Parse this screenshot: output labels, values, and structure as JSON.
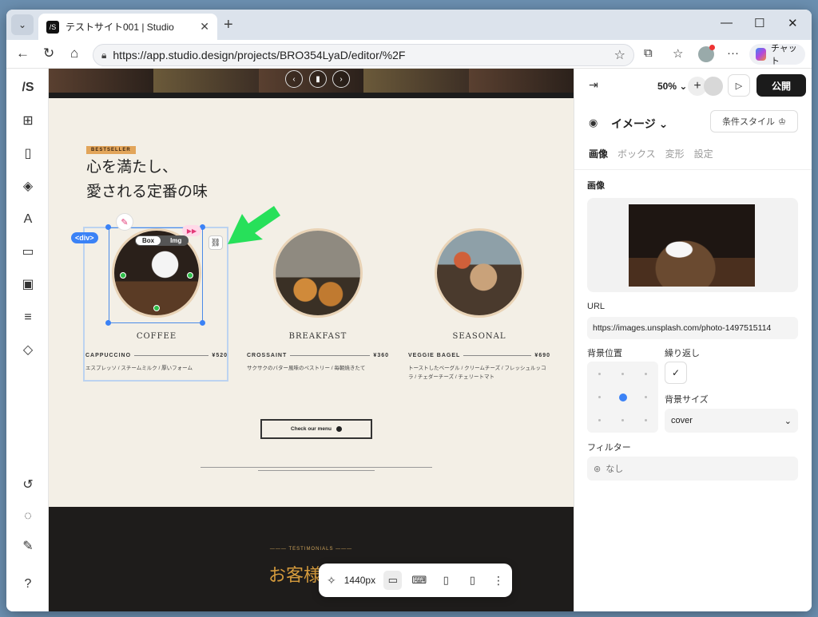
{
  "browser": {
    "tab_title": "テストサイト001 | Studio",
    "url": "https://app.studio.design/projects/BRO354LyaD/editor/%2F",
    "copilot_label": "チャット"
  },
  "canvas": {
    "badge": "BESTSELLER",
    "headline_line1": "心を満たし、",
    "headline_line2": "愛される定番の味",
    "items": [
      {
        "name": "COFFEE",
        "label": "CAPPUCCINO",
        "price": "¥520",
        "desc": "エスプレッソ / スチームミルク / 厚いフォーム"
      },
      {
        "name": "BREAKFAST",
        "label": "CROSSAINT",
        "price": "¥360",
        "desc": "サクサクのバター風味のペストリー / 毎朝焼きたて"
      },
      {
        "name": "SEASONAL",
        "label": "VEGGIE BAGEL",
        "price": "¥690",
        "desc": "トーストしたベーグル / クリームチーズ / フレッシュルッコラ / チェダーチーズ / チェリートマト"
      }
    ],
    "menu_button": "Check our menu",
    "testimonials_label": "TESTIMONIALS",
    "footer_heading": "お客様",
    "selection": {
      "div_tag": "<div>",
      "box_tab": "Box",
      "img_tab": "Img"
    }
  },
  "device_bar": {
    "width_label": "1440px"
  },
  "panel": {
    "zoom": "50%",
    "publish": "公開",
    "layer_type": "イメージ",
    "cond_style": "条件スタイル",
    "tabs": [
      "画像",
      "ボックス",
      "変形",
      "設定"
    ],
    "section_image": "画像",
    "url_label": "URL",
    "url_value": "https://images.unsplash.com/photo-1497515114",
    "bg_position_label": "背景位置",
    "repeat_label": "繰り返し",
    "bg_size_label": "背景サイズ",
    "bg_size_value": "cover",
    "filter_label": "フィルター",
    "filter_value": "なし"
  }
}
